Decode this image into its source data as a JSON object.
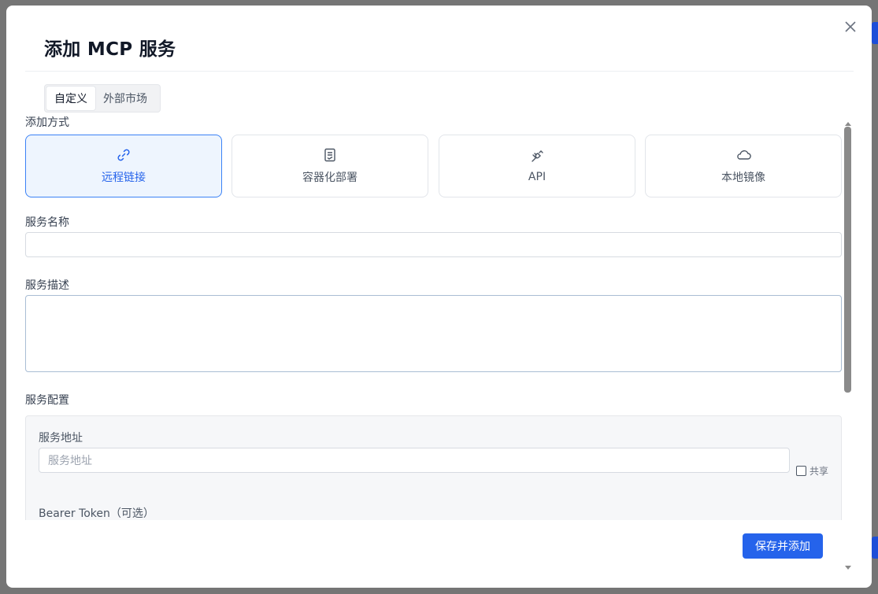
{
  "dialog": {
    "title": "添加 MCP 服务",
    "close_icon": "close-icon"
  },
  "tabs": [
    {
      "label": "自定义",
      "active": true
    },
    {
      "label": "外部市场",
      "active": false
    }
  ],
  "form": {
    "method_label": "添加方式",
    "methods": [
      {
        "label": "远程链接",
        "icon": "link-icon",
        "selected": true
      },
      {
        "label": "容器化部署",
        "icon": "document-icon",
        "selected": false
      },
      {
        "label": "API",
        "icon": "plug-icon",
        "selected": false
      },
      {
        "label": "本地镜像",
        "icon": "cloud-icon",
        "selected": false
      }
    ],
    "name_label": "服务名称",
    "name_value": "",
    "description_label": "服务描述",
    "description_value": "",
    "config_label": "服务配置",
    "config": {
      "address_label": "服务地址",
      "address_placeholder": "服务地址",
      "share_label": "共享",
      "share_checked": false,
      "token_label": "Bearer Token（可选）"
    }
  },
  "footer": {
    "save_label": "保存并添加"
  },
  "colors": {
    "accent": "#2563eb",
    "selected_card_bg": "#eef5fe"
  }
}
